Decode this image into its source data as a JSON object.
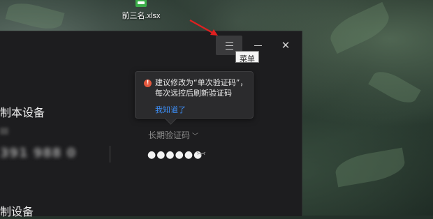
{
  "desktop": {
    "file_icon": {
      "label": "前三名.xlsx",
      "icon": "excel-file-icon",
      "color": "#3cae4a"
    }
  },
  "window": {
    "titlebar": {
      "menu_icon": "menu-icon",
      "minimize_icon": "minimize-icon",
      "close_icon": "close-icon",
      "close_glyph": "✕"
    },
    "tooltip": "菜单",
    "popover": {
      "warning_icon": "warning-icon",
      "warning_glyph": "!",
      "message": "建议修改为“单次验证码”，每次远控后刷新验证码",
      "link": "我知道了",
      "link_color": "#3d8ef5",
      "warning_color": "#e4573d"
    },
    "section_this_device": "制本设备",
    "device_code": "391 988 0",
    "code_type": {
      "label": "长期验证码",
      "chevron": "﹀"
    },
    "password_mask": "●●●●●●",
    "eye_icon": "eye-closed-icon",
    "section_remote": "制设备"
  },
  "annotation": {
    "arrow_color": "#e02020"
  }
}
